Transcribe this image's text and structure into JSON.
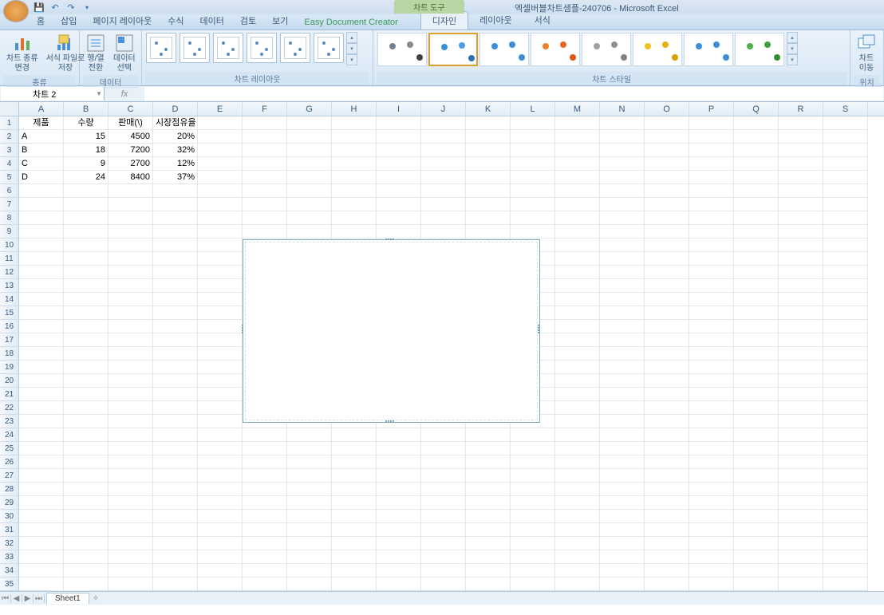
{
  "title": "엑셀버블차트샘플-240706 - Microsoft Excel",
  "context_tool_label": "차트 도구",
  "tabs": {
    "home": "홈",
    "insert": "삽입",
    "page_layout": "페이지 레이아웃",
    "formulas": "수식",
    "data": "데이터",
    "review": "검토",
    "view": "보기",
    "edc": "Easy Document Creator"
  },
  "context_tabs": {
    "design": "디자인",
    "layout": "레이아웃",
    "format": "서식"
  },
  "ribbon_groups": {
    "type": "종류",
    "data": "데이터",
    "chart_layouts": "차트 레이아웃",
    "chart_styles": "차트 스타일",
    "location": "위치"
  },
  "ribbon_buttons": {
    "change_chart_type": "차트 종류\n변경",
    "save_template": "서식 파일로\n저장",
    "switch_rowcol": "행/열\n전환",
    "select_data": "데이터\n선택",
    "move_chart": "차트\n이동"
  },
  "namebox_value": "차트 2",
  "formula_value": "",
  "headers": {
    "col": [
      "A",
      "B",
      "C",
      "D",
      "E",
      "F",
      "G",
      "H",
      "I",
      "J",
      "K",
      "L",
      "M",
      "N",
      "O",
      "P",
      "Q",
      "R",
      "S"
    ]
  },
  "table": {
    "header": [
      "제품",
      "수량",
      "판매(\\)",
      "시장점유율"
    ],
    "rows": [
      [
        "A",
        "15",
        "4500",
        "20%"
      ],
      [
        "B",
        "18",
        "7200",
        "32%"
      ],
      [
        "C",
        "9",
        "2700",
        "12%"
      ],
      [
        "D",
        "24",
        "8400",
        "37%"
      ]
    ]
  },
  "sheet_tabs": {
    "sheet1": "Sheet1"
  },
  "chart_styles_colors": [
    [
      "#708090",
      "#8a8a8a",
      "#404040"
    ],
    [
      "#3a8ed8",
      "#4aa0e8",
      "#2a70b8"
    ],
    [
      "#3a8ed8",
      "#3a8ed8",
      "#3a8ed8"
    ],
    [
      "#f08030",
      "#e86820",
      "#d85810"
    ],
    [
      "#a0a0a0",
      "#909090",
      "#808080"
    ],
    [
      "#f0c020",
      "#e8b010",
      "#d8a000"
    ],
    [
      "#3a8ed8",
      "#3a8ed8",
      "#3a8ed8"
    ],
    [
      "#50b050",
      "#40a040",
      "#309030"
    ]
  ]
}
